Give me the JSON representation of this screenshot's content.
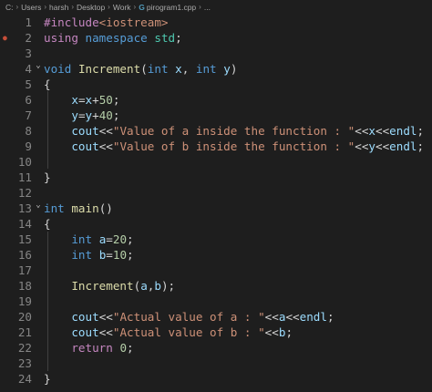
{
  "breadcrumb": {
    "items": [
      "C:",
      "Users",
      "harsh",
      "Desktop",
      "Work",
      "pirogram1.cpp",
      "..."
    ],
    "file_icon": "C++"
  },
  "editor": {
    "language": "cpp",
    "lines": [
      {
        "n": "1",
        "tokens": [
          {
            "t": "#include",
            "c": "kw2"
          },
          {
            "t": "<iostream>",
            "c": "str"
          }
        ]
      },
      {
        "n": "2",
        "tokens": [
          {
            "t": "using",
            "c": "kw2"
          },
          {
            "t": " ",
            "c": "op"
          },
          {
            "t": "namespace",
            "c": "kw"
          },
          {
            "t": " ",
            "c": "op"
          },
          {
            "t": "std",
            "c": "type"
          },
          {
            "t": ";",
            "c": "op"
          }
        ]
      },
      {
        "n": "3",
        "tokens": []
      },
      {
        "n": "4",
        "tokens": [
          {
            "t": "void",
            "c": "kw"
          },
          {
            "t": " ",
            "c": "op"
          },
          {
            "t": "Increment",
            "c": "fn"
          },
          {
            "t": "(",
            "c": "op"
          },
          {
            "t": "int",
            "c": "kw"
          },
          {
            "t": " ",
            "c": "op"
          },
          {
            "t": "x",
            "c": "id"
          },
          {
            "t": ", ",
            "c": "op"
          },
          {
            "t": "int",
            "c": "kw"
          },
          {
            "t": " ",
            "c": "op"
          },
          {
            "t": "y",
            "c": "id"
          },
          {
            "t": ")",
            "c": "op"
          }
        ]
      },
      {
        "n": "5",
        "tokens": [
          {
            "t": "{",
            "c": "op"
          }
        ]
      },
      {
        "n": "6",
        "tokens": [
          {
            "t": "    ",
            "c": "op"
          },
          {
            "t": "x",
            "c": "id"
          },
          {
            "t": "=",
            "c": "op"
          },
          {
            "t": "x",
            "c": "id"
          },
          {
            "t": "+",
            "c": "op"
          },
          {
            "t": "50",
            "c": "num"
          },
          {
            "t": ";",
            "c": "op"
          }
        ]
      },
      {
        "n": "7",
        "tokens": [
          {
            "t": "    ",
            "c": "op"
          },
          {
            "t": "y",
            "c": "id"
          },
          {
            "t": "=",
            "c": "op"
          },
          {
            "t": "y",
            "c": "id"
          },
          {
            "t": "+",
            "c": "op"
          },
          {
            "t": "40",
            "c": "num"
          },
          {
            "t": ";",
            "c": "op"
          }
        ]
      },
      {
        "n": "8",
        "tokens": [
          {
            "t": "    ",
            "c": "op"
          },
          {
            "t": "cout",
            "c": "id"
          },
          {
            "t": "<<",
            "c": "op"
          },
          {
            "t": "\"Value of a inside the function : \"",
            "c": "str"
          },
          {
            "t": "<<",
            "c": "op"
          },
          {
            "t": "x",
            "c": "id"
          },
          {
            "t": "<<",
            "c": "op"
          },
          {
            "t": "endl",
            "c": "id"
          },
          {
            "t": ";",
            "c": "op"
          }
        ]
      },
      {
        "n": "9",
        "tokens": [
          {
            "t": "    ",
            "c": "op"
          },
          {
            "t": "cout",
            "c": "id"
          },
          {
            "t": "<<",
            "c": "op"
          },
          {
            "t": "\"Value of b inside the function : \"",
            "c": "str"
          },
          {
            "t": "<<",
            "c": "op"
          },
          {
            "t": "y",
            "c": "id"
          },
          {
            "t": "<<",
            "c": "op"
          },
          {
            "t": "endl",
            "c": "id"
          },
          {
            "t": ";",
            "c": "op"
          }
        ]
      },
      {
        "n": "10",
        "tokens": []
      },
      {
        "n": "11",
        "tokens": [
          {
            "t": "}",
            "c": "op"
          }
        ]
      },
      {
        "n": "12",
        "tokens": []
      },
      {
        "n": "13",
        "tokens": [
          {
            "t": "int",
            "c": "kw"
          },
          {
            "t": " ",
            "c": "op"
          },
          {
            "t": "main",
            "c": "fn"
          },
          {
            "t": "()",
            "c": "op"
          }
        ]
      },
      {
        "n": "14",
        "tokens": [
          {
            "t": "{",
            "c": "op"
          }
        ]
      },
      {
        "n": "15",
        "tokens": [
          {
            "t": "    ",
            "c": "op"
          },
          {
            "t": "int",
            "c": "kw"
          },
          {
            "t": " ",
            "c": "op"
          },
          {
            "t": "a",
            "c": "id"
          },
          {
            "t": "=",
            "c": "op"
          },
          {
            "t": "20",
            "c": "num"
          },
          {
            "t": ";",
            "c": "op"
          }
        ]
      },
      {
        "n": "16",
        "tokens": [
          {
            "t": "    ",
            "c": "op"
          },
          {
            "t": "int",
            "c": "kw"
          },
          {
            "t": " ",
            "c": "op"
          },
          {
            "t": "b",
            "c": "id"
          },
          {
            "t": "=",
            "c": "op"
          },
          {
            "t": "10",
            "c": "num"
          },
          {
            "t": ";",
            "c": "op"
          }
        ]
      },
      {
        "n": "17",
        "tokens": []
      },
      {
        "n": "18",
        "tokens": [
          {
            "t": "    ",
            "c": "op"
          },
          {
            "t": "Increment",
            "c": "fn"
          },
          {
            "t": "(",
            "c": "op"
          },
          {
            "t": "a",
            "c": "id"
          },
          {
            "t": ",",
            "c": "op"
          },
          {
            "t": "b",
            "c": "id"
          },
          {
            "t": ");",
            "c": "op"
          }
        ]
      },
      {
        "n": "19",
        "tokens": []
      },
      {
        "n": "20",
        "tokens": [
          {
            "t": "    ",
            "c": "op"
          },
          {
            "t": "cout",
            "c": "id"
          },
          {
            "t": "<<",
            "c": "op"
          },
          {
            "t": "\"Actual value of a : \"",
            "c": "str"
          },
          {
            "t": "<<",
            "c": "op"
          },
          {
            "t": "a",
            "c": "id"
          },
          {
            "t": "<<",
            "c": "op"
          },
          {
            "t": "endl",
            "c": "id"
          },
          {
            "t": ";",
            "c": "op"
          }
        ]
      },
      {
        "n": "21",
        "tokens": [
          {
            "t": "    ",
            "c": "op"
          },
          {
            "t": "cout",
            "c": "id"
          },
          {
            "t": "<<",
            "c": "op"
          },
          {
            "t": "\"Actual value of b : \"",
            "c": "str"
          },
          {
            "t": "<<",
            "c": "op"
          },
          {
            "t": "b",
            "c": "id"
          },
          {
            "t": ";",
            "c": "op"
          }
        ]
      },
      {
        "n": "22",
        "tokens": [
          {
            "t": "    ",
            "c": "op"
          },
          {
            "t": "return",
            "c": "kw2"
          },
          {
            "t": " ",
            "c": "op"
          },
          {
            "t": "0",
            "c": "num"
          },
          {
            "t": ";",
            "c": "op"
          }
        ]
      },
      {
        "n": "23",
        "tokens": []
      },
      {
        "n": "24",
        "tokens": [
          {
            "t": "}",
            "c": "op"
          }
        ]
      }
    ],
    "fold_lines": [
      "4",
      "13"
    ],
    "modified_lines": [
      "2"
    ]
  },
  "colors": {
    "background": "#1e1e1e",
    "line_number": "#858585",
    "keyword": "#569cd6",
    "control": "#c586c0",
    "function": "#dcdcaa",
    "variable": "#9cdcfe",
    "string": "#ce9178",
    "number": "#b5cea8",
    "type": "#4ec9b0"
  }
}
